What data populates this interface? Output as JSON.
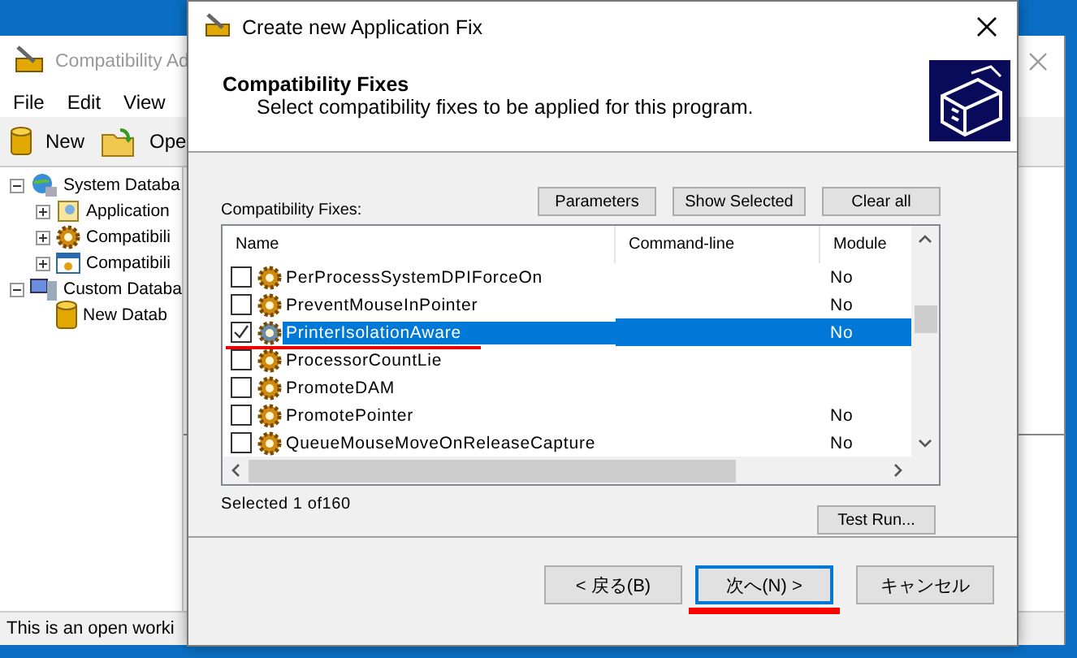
{
  "main_window": {
    "title": "Compatibility Ad",
    "menu": [
      "File",
      "Edit",
      "View"
    ],
    "toolbar": [
      {
        "kind": "database",
        "label": "New"
      },
      {
        "kind": "folder",
        "label": "Ope"
      }
    ],
    "tree": [
      {
        "label": "System Databa",
        "kind": "system",
        "expanded": true,
        "children": [
          {
            "label": "Application",
            "kind": "apps",
            "expanded": false
          },
          {
            "label": "Compatibili",
            "kind": "gear",
            "expanded": false
          },
          {
            "label": "Compatibili",
            "kind": "window",
            "expanded": false
          }
        ]
      },
      {
        "label": "Custom Databa",
        "kind": "custom",
        "expanded": true,
        "children": [
          {
            "label": "New Datab",
            "kind": "database"
          }
        ]
      }
    ],
    "status_bar": "This is an open worki"
  },
  "dialog": {
    "title": "Create new Application Fix",
    "header": {
      "title": "Compatibility Fixes",
      "subtitle": "Select compatibility fixes to be applied for this program."
    },
    "list_label": "Compatibility Fixes:",
    "buttons": [
      "Parameters",
      "Show Selected",
      "Clear all"
    ],
    "columns": [
      "Name",
      "Command-line",
      "Module"
    ],
    "rows": [
      {
        "name": "PerProcessSystemDPIForceOn",
        "module": "No",
        "checked": false,
        "selected": false
      },
      {
        "name": "PreventMouseInPointer",
        "module": "No",
        "checked": false,
        "selected": false
      },
      {
        "name": "PrinterIsolationAware",
        "module": "No",
        "checked": true,
        "selected": true
      },
      {
        "name": "ProcessorCountLie",
        "checked": false,
        "selected": false
      },
      {
        "name": "PromoteDAM",
        "checked": false,
        "selected": false
      },
      {
        "name": "PromotePointer",
        "module": "No",
        "checked": false,
        "selected": false
      },
      {
        "name": "QueueMouseMoveOnReleaseCapture",
        "module": "No",
        "checked": false,
        "selected": false
      }
    ],
    "selection_count": "Selected 1 of160",
    "test_button": "Test Run...",
    "nav_buttons": [
      {
        "label": "< 戻る(B)",
        "focused": false
      },
      {
        "label": "次へ(N) >",
        "focused": true
      },
      {
        "label": "キャンセル",
        "focused": false
      }
    ]
  }
}
